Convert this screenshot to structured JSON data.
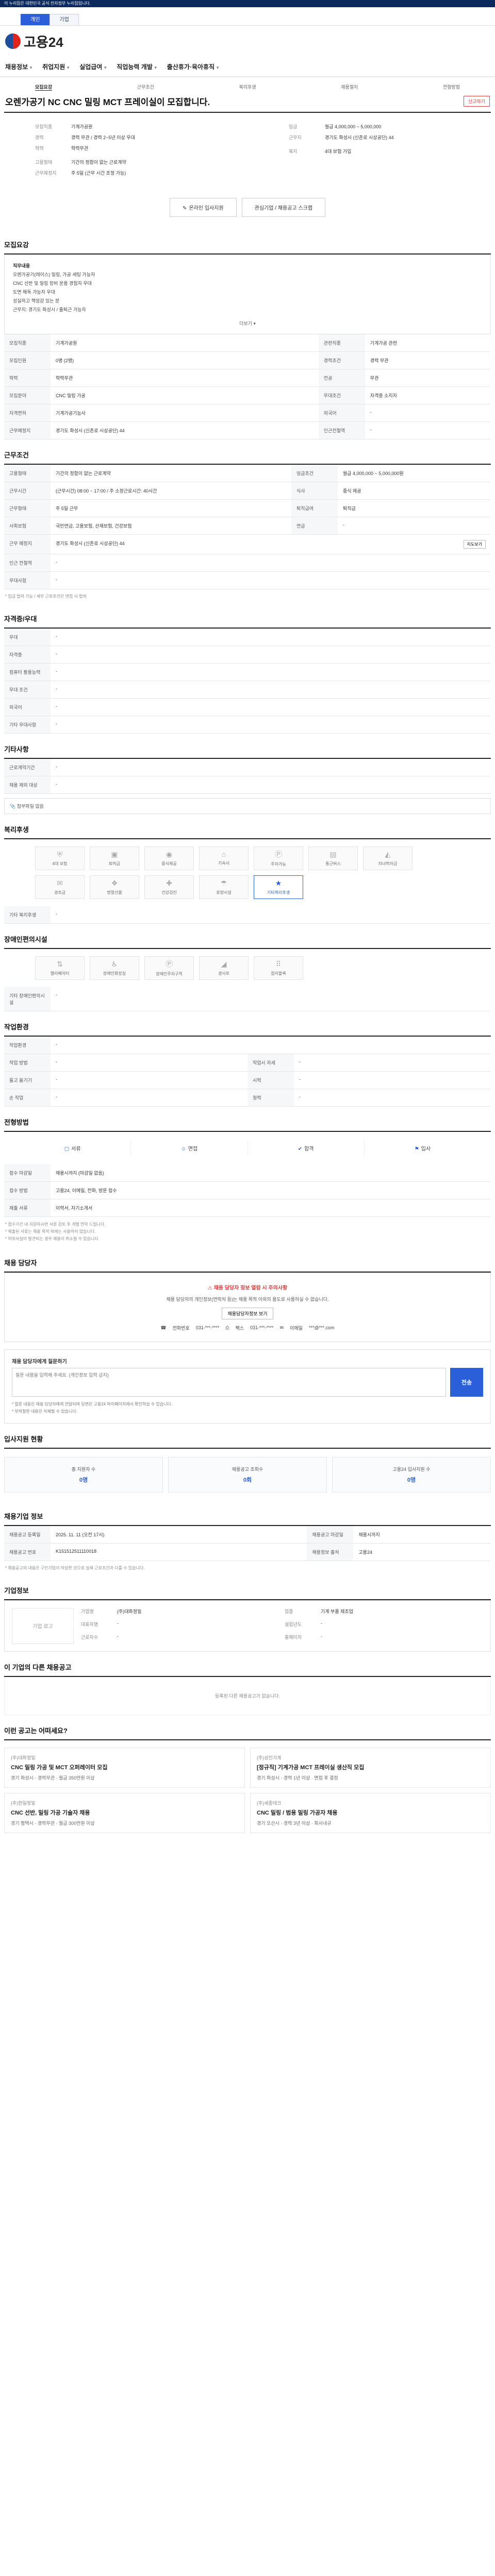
{
  "gov_banner": "이 누리집은 대한민국 공식 전자정부 누리집입니다.",
  "util_tabs": [
    "개인",
    "기업"
  ],
  "logo_text": "고용24",
  "gnb": [
    "채용정보",
    "취업지원",
    "실업급여",
    "직업능력 개발",
    "출산휴가·육아휴직"
  ],
  "detail_tabs": [
    "모집요강",
    "근무조건",
    "복리후생",
    "채용절차",
    "전형방법"
  ],
  "title": "오렌가공기 NC CNC 밀링 MCT 프레이실이 모집합니다.",
  "report_label": "신고하기",
  "summary_left": [
    {
      "k": "모집직종",
      "v": "기계가공원"
    },
    {
      "k": "경력",
      "v": "경력 무관 / 경력 2~5년 이상 우대"
    },
    {
      "k": "학력",
      "v": "학력무관"
    },
    {
      "k": "고용형태",
      "v": "기간의 정함이 없는 근로계약"
    },
    {
      "k": "근무예정지",
      "v": "주 5일 (근무 시간 조정 가능)"
    }
  ],
  "summary_right": [
    {
      "k": "임금",
      "v": "월급 4,000,000 ~ 5,000,000"
    },
    {
      "k": "근무지",
      "v": "경기도 화성시 (신촌로 시상공단) 44"
    },
    {
      "k": "복지",
      "v": "4대 보험 가입"
    }
  ],
  "btn_apply": "온라인 입사지원",
  "btn_interest": "관심기업 등록하기",
  "btn_apply_online": "관심기업 / 채용공고 스크랩",
  "sec_recruit": "모집요강",
  "recruit_lines": [
    {
      "strong": true,
      "t": "직무내용"
    },
    {
      "strong": false,
      "t": "오렌가공기(레이스) 밀링, 가공 세팅 가능자"
    },
    {
      "strong": false,
      "t": "CNC 선반 및 밀링 장비 운용 경험자 우대"
    },
    {
      "strong": false,
      "t": "도면 해독 가능자 우대"
    },
    {
      "strong": false,
      "t": "성실하고 책임감 있는 분"
    },
    {
      "strong": false,
      "t": "근무지: 경기도 화성시 / 출퇴근 가능자"
    }
  ],
  "more_label": "더보기",
  "recruit_table": [
    {
      "k": "모집직종",
      "v": "기계가공원",
      "k2": "관련직종",
      "v2": "기계가공 관련"
    },
    {
      "k": "모집인원",
      "v": "0명 (2명)",
      "k2": "경력조건",
      "v2": "경력 무관"
    },
    {
      "k": "학력",
      "v": "학력무관",
      "k2": "전공",
      "v2": "무관"
    },
    {
      "k": "모집분야",
      "v": "CNC 밀링 가공",
      "k2": "우대조건",
      "v2": "자격증 소지자"
    },
    {
      "k": "자격면허",
      "v": "기계가공기능사",
      "k2": "외국어",
      "v2": "-"
    },
    {
      "k": "근무예정지",
      "v": "경기도 화성시 (신촌로 시상공단) 44",
      "k2": "인근전철역",
      "v2": "-"
    }
  ],
  "sec_work": "근무조건",
  "work_table": [
    {
      "k": "고용형태",
      "v": "기간의 정함이 없는 근로계약",
      "k2": "임금조건",
      "v2": "월급 4,000,000 ~ 5,000,000원"
    },
    {
      "k": "근무시간",
      "v": "(근무시간) 08:00 ~ 17:00 / 주 소정근로시간: 40시간",
      "k2": "식사",
      "v2": "중식 제공"
    },
    {
      "k": "근무형태",
      "v": "주 5일 근무",
      "k2": "퇴직급여",
      "v2": "퇴직금"
    },
    {
      "k": "사회보험",
      "v": "국민연금, 고용보험, 산재보험, 건강보험",
      "k2": "연금",
      "v2": "-"
    },
    {
      "k": "근무 예정지",
      "v": "경기도 화성시 (신촌로 시상공단) 44",
      "k2": "",
      "v2": ""
    },
    {
      "k": "인근 전철역",
      "v": "-",
      "k2": "",
      "v2": ""
    },
    {
      "k": "우대사항",
      "v": "-",
      "k2": "",
      "v2": ""
    }
  ],
  "work_note": "* 임금 협의 가능 / 세부 근로조건은 면접 시 협의",
  "map_btn": "지도보기",
  "sec_license": "자격증/우대",
  "license_table": [
    {
      "k": "우대",
      "v": "-"
    },
    {
      "k": "자격증",
      "v": "-"
    },
    {
      "k": "컴퓨터 활용능력",
      "v": "-"
    },
    {
      "k": "우대 조건",
      "v": "-"
    },
    {
      "k": "외국어",
      "v": "-"
    },
    {
      "k": "기타 우대사항",
      "v": "-"
    }
  ],
  "sec_etc": "기타사항",
  "etc_table": [
    {
      "k": "근로계약기간",
      "v": "-"
    },
    {
      "k": "채용 제외 대상",
      "v": "-"
    }
  ],
  "file_label": "첨부파일 없음",
  "sec_welfare": "복리후생",
  "welfare_items": [
    "4대 보험",
    "퇴직금",
    "중식제공",
    "기숙사",
    "주차가능",
    "통근버스",
    "자녀학자금",
    "경조금",
    "명절선물",
    "건강검진",
    "휴양시설",
    "기타복리후생"
  ],
  "welfare_active": "기타복리후생",
  "welfare_note": "기타 복리후생",
  "sec_disabled": "장애인편의시설",
  "disabled_items": [
    "엘리베이터",
    "장애인화장실",
    "장애인주차구역",
    "경사로",
    "점자블록"
  ],
  "disabled_note": "기타 장애인편의시설",
  "sec_place": "작업환경",
  "place_table": [
    {
      "k": "작업환경",
      "v": "-",
      "k2": "",
      "v2": ""
    },
    {
      "k": "작업 방법",
      "v": "-",
      "k2": "작업시 자세",
      "v2": "-"
    },
    {
      "k": "들고 옮기기",
      "v": "-",
      "k2": "시력",
      "v2": "-"
    },
    {
      "k": "손 작업",
      "v": "-",
      "k2": "청력",
      "v2": "-"
    }
  ],
  "sec_process": "전형방법",
  "process_steps": [
    "서류",
    "면접",
    "합격",
    "입사"
  ],
  "process_table": [
    {
      "k": "접수 마감일",
      "v": "채용시까지 (마감일 없음)"
    },
    {
      "k": "접수 방법",
      "v": "고용24, 이메일, 전화, 방문 접수"
    },
    {
      "k": "제출 서류",
      "v": "이력서, 자기소개서"
    }
  ],
  "process_notes": [
    "* 접수기간 내 지원하시면 서류 검토 후 개별 연락 드립니다.",
    "* 제출된 서류는 채용 목적 외에는 사용하지 않습니다.",
    "* 허위사실이 발견되는 경우 채용이 취소될 수 있습니다."
  ],
  "sec_contact": "채용 담당자",
  "contact_warn": "채용 담당자 정보 열람 시 주의사항",
  "contact_text": "채용 담당자의 개인정보(연락처 등)는 채용 목적 이외의 용도로 사용하실 수 없습니다.",
  "contact_btn": "채용담당자정보 보기",
  "contact_phone_k": "전화번호",
  "contact_phone": "031-***-****",
  "contact_fax_k": "팩스",
  "contact_fax": "031-***-****",
  "contact_email_k": "이메일",
  "contact_email": "***@***.com",
  "inquiry_label": "채용 담당자에게 질문하기",
  "inquiry_placeholder": "질문 내용을 입력해 주세요. (개인정보 입력 금지)",
  "inquiry_send": "전송",
  "inquiry_notes": [
    "* 질문 내용은 채용 담당자에게 전달되며 답변은 고용24 마이페이지에서 확인하실 수 있습니다.",
    "* 부적절한 내용은 삭제될 수 있습니다."
  ],
  "sec_stat": "입사지원 현황",
  "stats": [
    {
      "label": "총 지원자 수",
      "num": "0명"
    },
    {
      "label": "채용공고 조회수",
      "num": "0회"
    },
    {
      "label": "고용24 입사지원 수",
      "num": "0명"
    }
  ],
  "sec_info": "채용기업 정보",
  "info_table": [
    {
      "k": "채용공고 등록일",
      "v": "2025. 11. 11 (오전 17시)",
      "k2": "채용공고 마감일",
      "v2": "채용시까지"
    },
    {
      "k": "채용공고 번호",
      "v": "K151512511110018",
      "k2": "채용정보 출처",
      "v2": "고용24"
    }
  ],
  "info_note": "* 채용공고의 내용은 구인기업이 작성한 것으로 실제 근로조건과 다를 수 있습니다.",
  "sec_company": "기업정보",
  "company_logo": "기업 로고",
  "company": [
    {
      "k": "기업명",
      "v": "(주)대화정밀"
    },
    {
      "k": "업종",
      "v": "기계 부품 제조업"
    },
    {
      "k": "대표자명",
      "v": "-"
    },
    {
      "k": "설립년도",
      "v": "-"
    },
    {
      "k": "근로자수",
      "v": "-"
    },
    {
      "k": "홈페이지",
      "v": "-"
    }
  ],
  "sec_similar": "이 기업의 다른 채용공고",
  "similar_none": "등록된 다른 채용공고가 없습니다.",
  "sec_related": "이런 공고는 어떠세요?",
  "jobs": [
    {
      "co": "(주)대화정밀",
      "title": "CNC 밀링 가공 및 MCT 오퍼레이터 모집",
      "meta": "경기 화성시 · 경력무관 · 월급 350만원 이상"
    },
    {
      "co": "(주)성진기계",
      "title": "[정규직] 기계가공 MCT 프레이실 생산직 모집",
      "meta": "경기 화성시 · 경력 1년 이상 · 면접 후 결정"
    },
    {
      "co": "(주)한일정밀",
      "title": "CNC 선반, 밀링 가공 기술자 채용",
      "meta": "경기 평택시 · 경력무관 · 월급 300만원 이상"
    },
    {
      "co": "(주)세종테크",
      "title": "CNC 밀링 / 범용 밀링 가공자 채용",
      "meta": "경기 오산시 · 경력 3년 이상 · 회사내규"
    }
  ]
}
